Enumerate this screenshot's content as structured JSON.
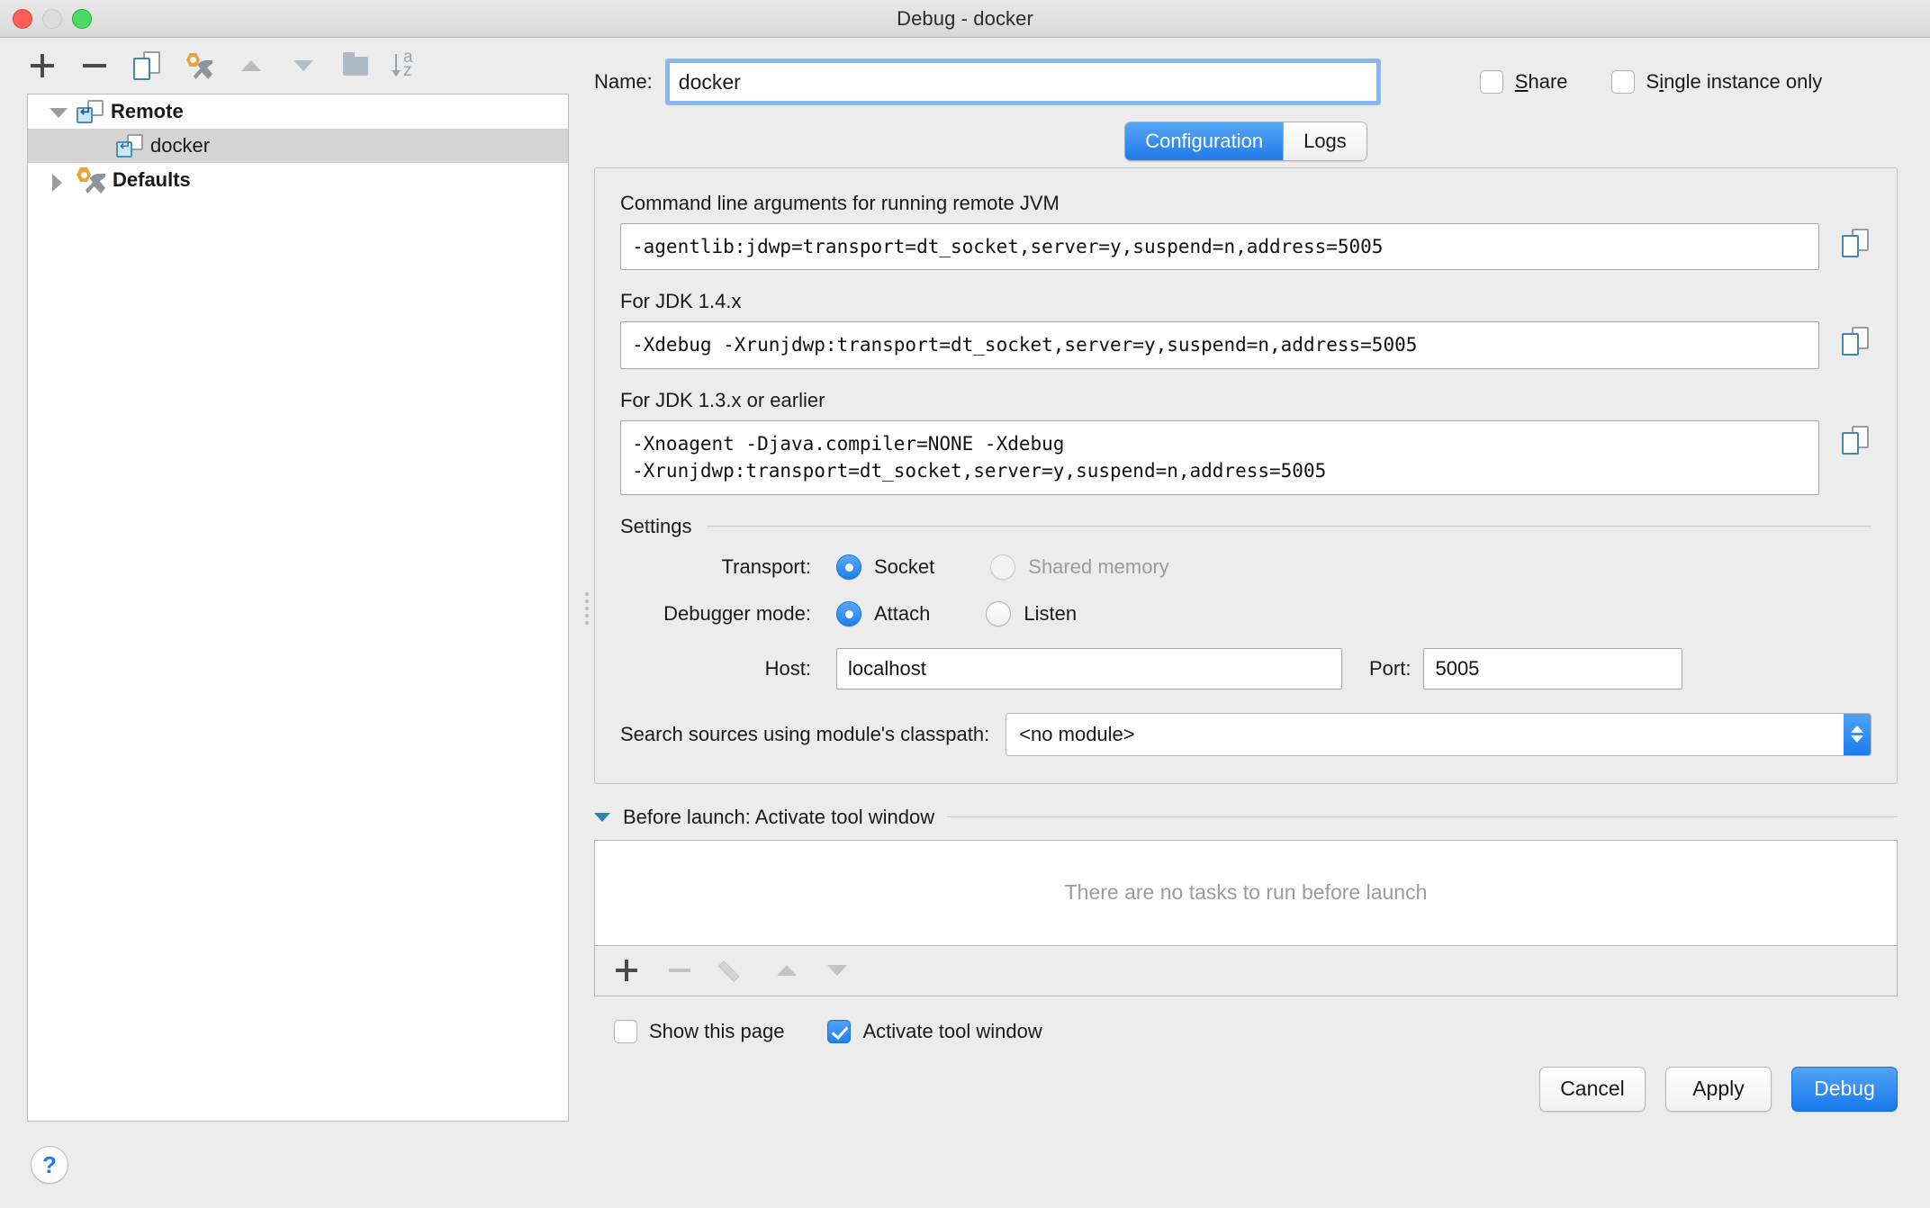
{
  "window": {
    "title": "Debug - docker"
  },
  "tree_toolbar": {
    "add": "add-icon",
    "remove": "remove-icon",
    "copy": "copy-configuration-icon",
    "edit_defaults": "edit-defaults-icon",
    "move_up": "move-up-icon",
    "move_down": "move-down-icon",
    "folder": "new-folder-icon",
    "sort": "sort-alphabetically-icon"
  },
  "tree": {
    "items": [
      {
        "label": "Remote",
        "level": 0,
        "expanded": true,
        "selected": false,
        "icon": "remote-config-icon"
      },
      {
        "label": "docker",
        "level": 1,
        "expanded": false,
        "selected": true,
        "icon": "remote-config-icon"
      },
      {
        "label": "Defaults",
        "level": 0,
        "expanded": false,
        "selected": false,
        "icon": "defaults-wrench-icon"
      }
    ]
  },
  "help": {
    "label": "?"
  },
  "name": {
    "label": "Name:",
    "value": "docker"
  },
  "top_checkboxes": [
    {
      "label": "Share",
      "mnemonic": "S",
      "checked": false
    },
    {
      "label": "Single instance only",
      "mnemonic": "i",
      "checked": false
    }
  ],
  "tabs": [
    {
      "label": "Configuration",
      "active": true
    },
    {
      "label": "Logs",
      "active": false
    }
  ],
  "configuration": {
    "arg_fields": [
      {
        "label": "Command line arguments for running remote JVM",
        "value": "-agentlib:jdwp=transport=dt_socket,server=y,suspend=n,address=5005",
        "copy_icon": "copy-to-clipboard-icon"
      },
      {
        "label": "For JDK 1.4.x",
        "value": "-Xdebug -Xrunjdwp:transport=dt_socket,server=y,suspend=n,address=5005",
        "copy_icon": "copy-to-clipboard-icon"
      },
      {
        "label": "For JDK 1.3.x or earlier",
        "value": "-Xnoagent -Djava.compiler=NONE -Xdebug\n-Xrunjdwp:transport=dt_socket,server=y,suspend=n,address=5005",
        "copy_icon": "copy-to-clipboard-icon"
      }
    ],
    "settings_group_title": "Settings",
    "transport": {
      "label": "Transport:",
      "options": [
        {
          "label": "Socket",
          "selected": true,
          "disabled": false
        },
        {
          "label": "Shared memory",
          "selected": false,
          "disabled": true
        }
      ]
    },
    "debugger_mode": {
      "label": "Debugger mode:",
      "options": [
        {
          "label": "Attach",
          "selected": true,
          "disabled": false
        },
        {
          "label": "Listen",
          "selected": false,
          "disabled": false
        }
      ]
    },
    "host": {
      "label": "Host:",
      "value": "localhost"
    },
    "port": {
      "label": "Port:",
      "value": "5005"
    },
    "classpath": {
      "label": "Search sources using module's classpath:",
      "value": "<no module>"
    }
  },
  "before_launch": {
    "title": "Before launch: Activate tool window",
    "empty_text": "There are no tasks to run before launch",
    "toolbar": {
      "add": "add-task-icon",
      "remove": "remove-task-icon",
      "edit": "edit-task-icon",
      "move_up": "move-task-up-icon",
      "move_down": "move-task-down-icon"
    }
  },
  "bottom_checkboxes": [
    {
      "label": "Show this page",
      "checked": false
    },
    {
      "label": "Activate tool window",
      "checked": true
    }
  ],
  "buttons": [
    {
      "label": "Cancel",
      "primary": false
    },
    {
      "label": "Apply",
      "primary": false
    },
    {
      "label": "Debug",
      "primary": true
    }
  ],
  "colors": {
    "accent_blue": "#1e81ef",
    "window_bg": "#ececec",
    "selection_gray": "#d4d4d4",
    "disabled_text": "#9b9b9b"
  }
}
